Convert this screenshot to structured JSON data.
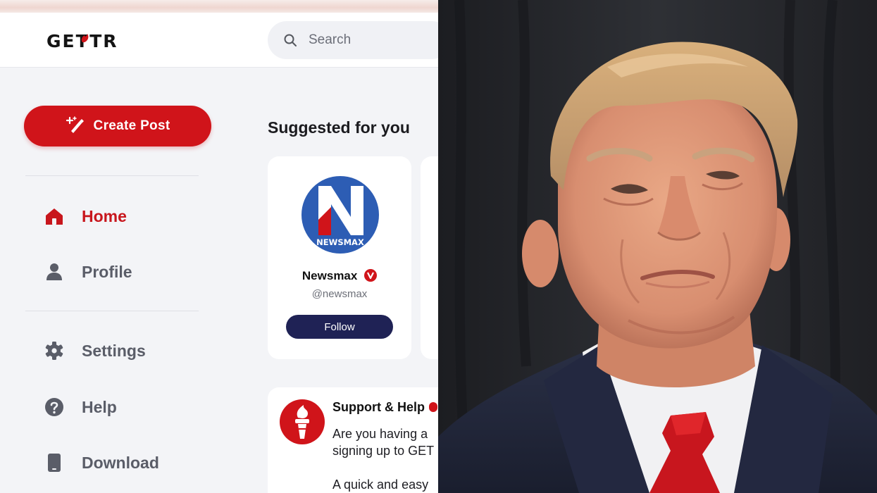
{
  "app": {
    "logo_text": "GETTR",
    "brand_color": "#d0141a",
    "navy": "#1f2255"
  },
  "search": {
    "placeholder": "Search",
    "icon": "search-icon"
  },
  "sidebar": {
    "create_post": {
      "label": "Create Post",
      "icon": "magic-pen-icon"
    },
    "items": [
      {
        "label": "Home",
        "icon": "home-icon",
        "active": true
      },
      {
        "label": "Profile",
        "icon": "user-icon",
        "active": false
      },
      {
        "label": "Settings",
        "icon": "gear-icon",
        "active": false
      },
      {
        "label": "Help",
        "icon": "help-circle-icon",
        "active": false
      },
      {
        "label": "Download",
        "icon": "phone-icon",
        "active": false
      }
    ]
  },
  "suggested": {
    "title": "Suggested for you",
    "cards": [
      {
        "name": "Newsmax",
        "handle": "@newsmax",
        "avatar_text": "NEWSMAX",
        "avatar_letter": "N",
        "verified_icon": "verified-badge-icon",
        "follow_label": "Follow"
      }
    ]
  },
  "post": {
    "author": "Support & Help",
    "avatar_icon": "torch-icon",
    "lines": [
      "Are you having a",
      "signing up to GET",
      "A quick and easy"
    ]
  },
  "photo": {
    "subject": "portrait-photo"
  }
}
